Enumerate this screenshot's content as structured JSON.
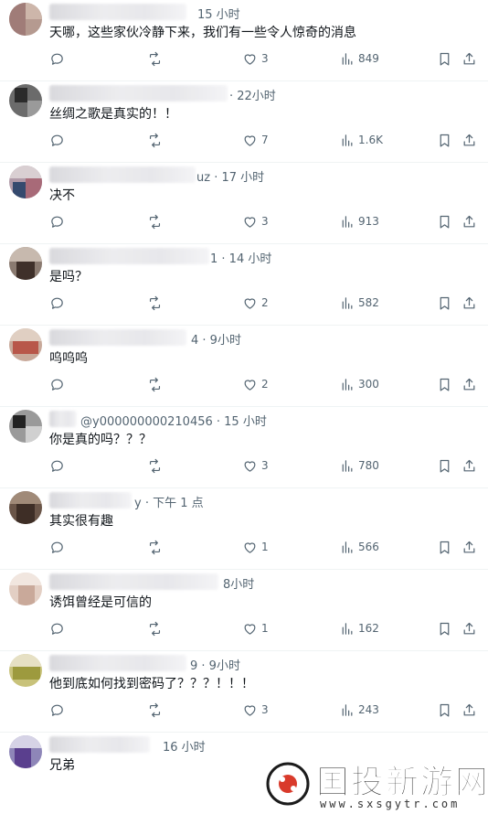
{
  "replies": [
    {
      "time": "15 小时",
      "text": "天哪，这些家伙冷静下来，我们有一些令人惊奇的消息",
      "likes": "3",
      "views": "849"
    },
    {
      "time": "· 22小时",
      "text": "丝绸之歌是真实的！！",
      "likes": "7",
      "views": "1.6K"
    },
    {
      "time": "uz · 17 小时",
      "text": "决不",
      "likes": "3",
      "views": "913"
    },
    {
      "time": "1 · 14 小时",
      "text": "是吗？",
      "likes": "2",
      "views": "582"
    },
    {
      "time": "4 · 9小时",
      "text": "呜呜呜",
      "likes": "2",
      "views": "300"
    },
    {
      "time": "@y000000000210456 · 15 小时",
      "text": "你是真的吗？？？",
      "likes": "3",
      "views": "780"
    },
    {
      "time": "y · 下午 1 点",
      "text": "其实很有趣",
      "likes": "1",
      "views": "566"
    },
    {
      "time": "8小时",
      "text": "诱饵曾经是可信的",
      "likes": "1",
      "views": "162"
    },
    {
      "time": "9 · 9小时",
      "text": "他到底如何找到密码了？？？！！！",
      "likes": "3",
      "views": "243"
    },
    {
      "time": "16 小时",
      "text": "兄弟"
    }
  ],
  "watermark": {
    "title": "国投新游网",
    "url": "www.sxsgytr.com"
  },
  "icons": {
    "reply": "reply-icon",
    "retweet": "retweet-icon",
    "like": "heart-icon",
    "views": "views-icon",
    "bookmark": "bookmark-icon",
    "share": "share-icon"
  }
}
